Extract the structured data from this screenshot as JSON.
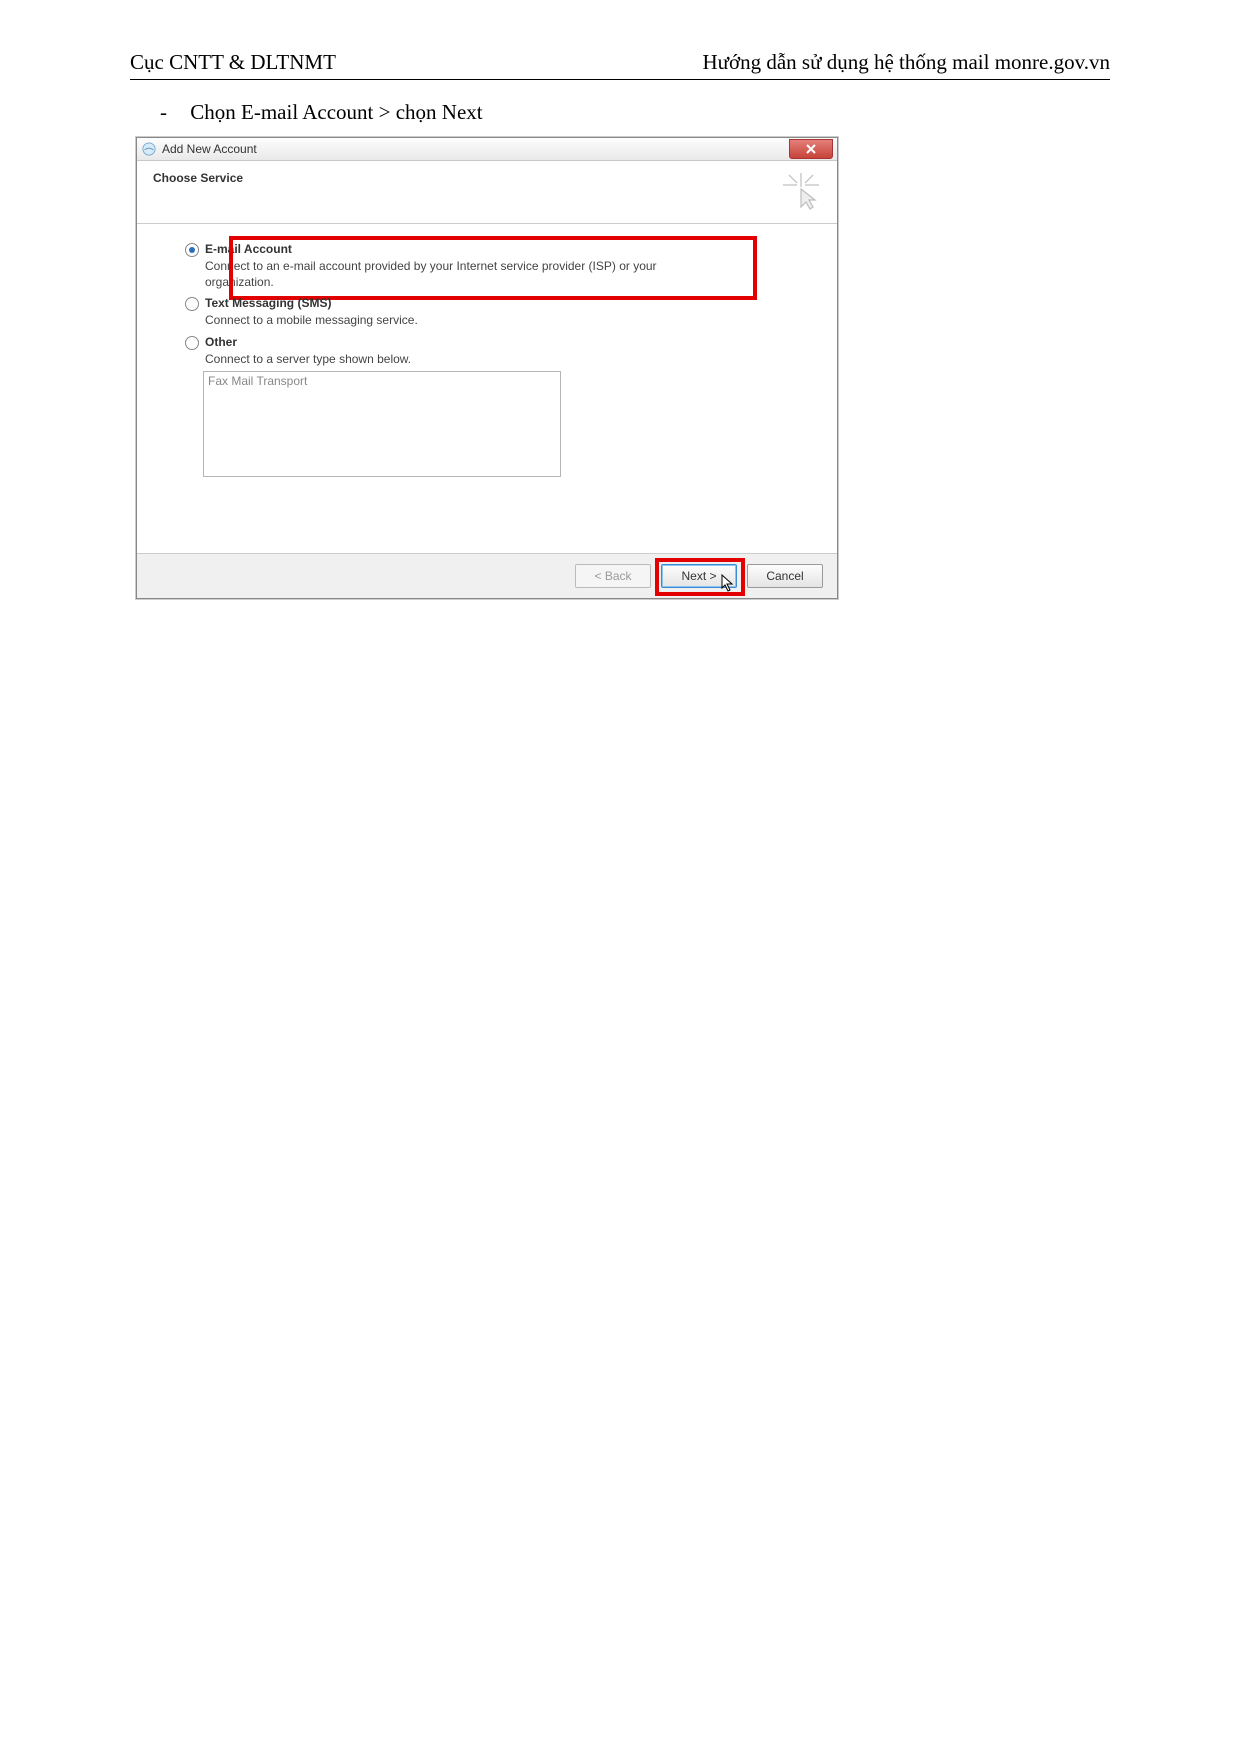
{
  "doc": {
    "left_header": "Cục CNTT & DLTNMT",
    "right_header": "Hướng dẫn sử dụng hệ thống mail monre.gov.vn",
    "instruction": "Chọn E-mail Account > chọn Next"
  },
  "dialog": {
    "title": "Add New Account",
    "wizard_title": "Choose Service",
    "options": {
      "email": {
        "label": "E-mail Account",
        "desc": "Connect to an e-mail account provided by your Internet service provider (ISP) or your organization."
      },
      "sms": {
        "label": "Text Messaging (SMS)",
        "desc": "Connect to a mobile messaging service."
      },
      "other": {
        "label": "Other",
        "desc": "Connect to a server type shown below.",
        "list_item": "Fax Mail Transport"
      }
    },
    "buttons": {
      "back": "< Back",
      "next": "Next >",
      "cancel": "Cancel"
    }
  }
}
